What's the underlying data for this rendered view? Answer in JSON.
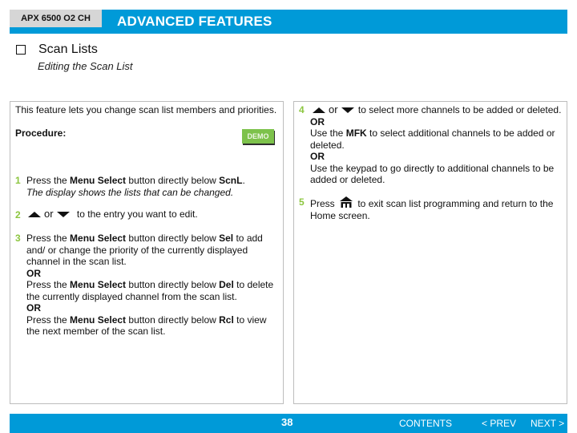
{
  "header": {
    "model": "APX 6500 O2 CH",
    "title": "ADVANCED FEATURES",
    "color": "#009ad8"
  },
  "section": {
    "title": "Scan Lists",
    "subtitle": "Editing the Scan List"
  },
  "left_panel": {
    "intro": "This feature lets you change scan list members and priorities.",
    "procedure_label": "Procedure:",
    "demo_button": "DEMO",
    "steps": [
      {
        "num": "1",
        "parts": {
          "a": "Press the ",
          "b": "Menu Select",
          "c": " button directly below ",
          "d": "ScnL",
          "e": ".",
          "note": "The display shows the lists that can be changed."
        }
      },
      {
        "num": "2",
        "or_word": "or",
        "text": "to the entry you want to edit.",
        "icons": [
          "up-arrow-icon",
          "down-arrow-icon"
        ]
      },
      {
        "num": "3",
        "a1": "Press the ",
        "b1": "Menu Select",
        "c1": " button directly below ",
        "d1": "Sel",
        "e1": " to add and/ or change the priority of the currently displayed channel in the scan list.",
        "or1": "OR",
        "a2": "Press the ",
        "b2": "Menu Select",
        "c2": " button directly below ",
        "d2": "Del",
        "e2": " to delete the currently displayed channel from the scan list.",
        "or2": "OR",
        "a3": "Press the ",
        "b3": "Menu Select",
        "c3": " button directly below ",
        "d3": "Rcl",
        "e3": " to view the next member of the scan list."
      }
    ]
  },
  "right_panel": {
    "steps": [
      {
        "num": "4",
        "or_word": "or",
        "text": "to select more channels to be added or deleted.",
        "or1": "OR",
        "a2": "Use the ",
        "b2": "MFK",
        "c2": " to select additional channels to be added or deleted.",
        "or2": "OR",
        "text3": "Use the keypad to go directly to additional channels to be added or deleted."
      },
      {
        "num": "5",
        "a": "Press ",
        "c": " to exit scan list programming and return to the Home screen.",
        "icon": "home-icon"
      }
    ]
  },
  "footer": {
    "page": "38",
    "contents": "CONTENTS",
    "prev": "< PREV",
    "next": "NEXT >"
  },
  "colors": {
    "step_number": "#8cc63f",
    "demo_button": "#7dc24b",
    "bar": "#009ad8"
  }
}
